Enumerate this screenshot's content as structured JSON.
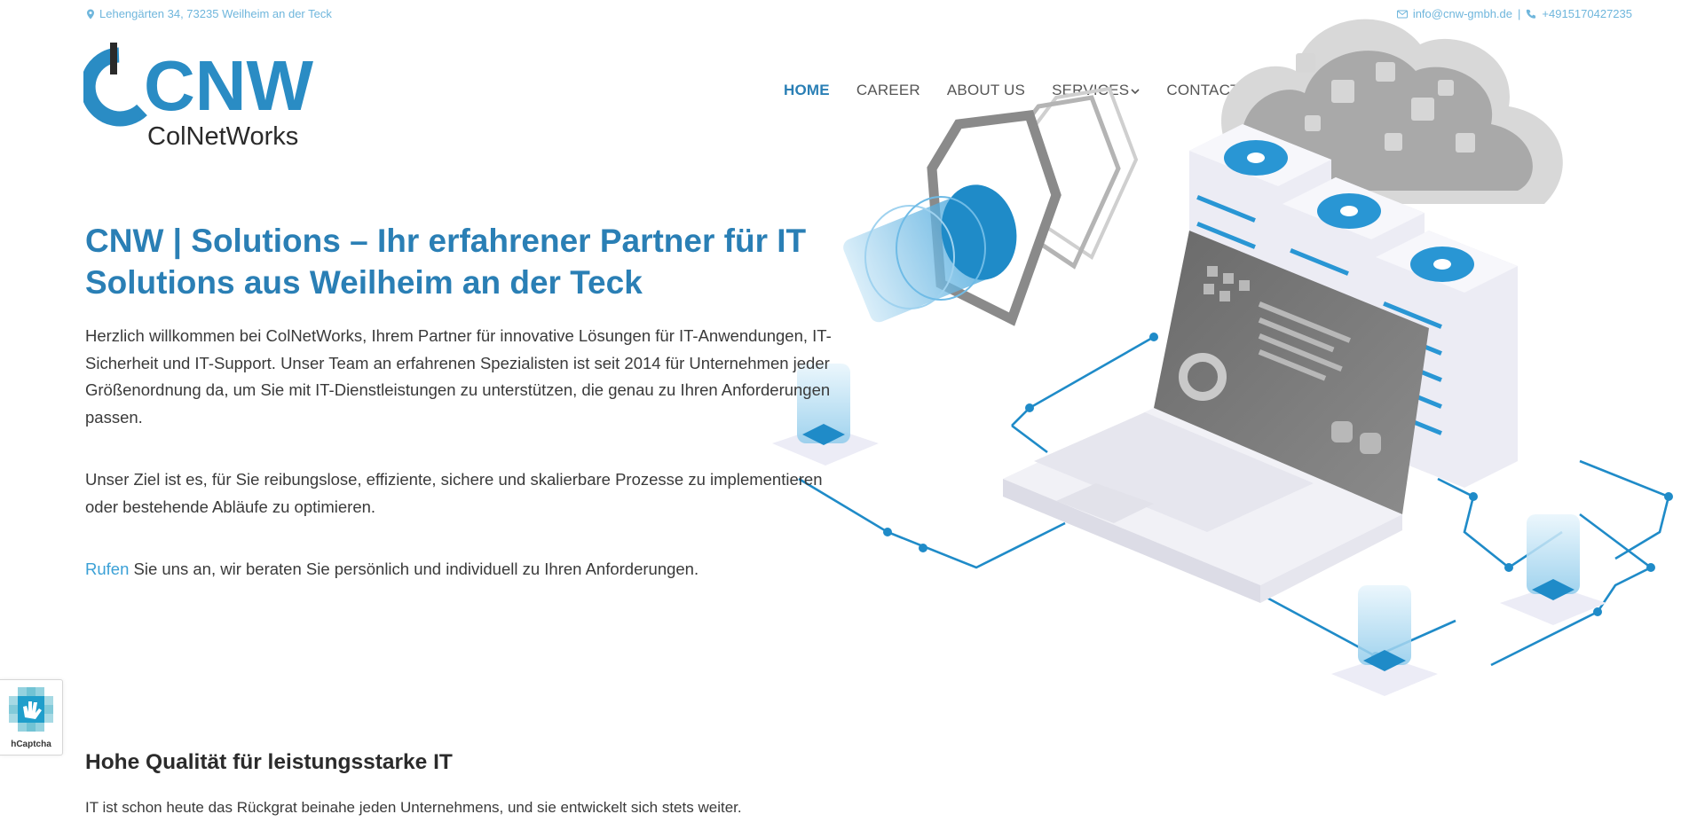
{
  "topbar": {
    "address": "Lehengärten 34, 73235 Weilheim an der Teck",
    "email": "info@cnw-gmbh.de",
    "separator": "|",
    "phone": "+4915170427235"
  },
  "logo": {
    "mark": "CNW",
    "name": "ColNetWorks"
  },
  "nav": {
    "items": [
      {
        "label": "HOME"
      },
      {
        "label": "CAREER"
      },
      {
        "label": "ABOUT US"
      },
      {
        "label": "SERVICES"
      },
      {
        "label": "CONTACT"
      }
    ]
  },
  "hero": {
    "title": "CNW | Solutions – Ihr erfahrener Partner für IT Solutions aus Weilheim an der Teck",
    "paragraph1": "Herzlich willkommen bei ColNetWorks, Ihrem Partner für innovative Lösungen für IT-Anwendungen, IT-Sicherheit und IT-Support. Unser Team an erfahrenen Spezialisten ist seit 2014 für Unternehmen jeder Größenordnung da, um Sie mit IT-Dienstleistungen zu unterstützen, die genau zu Ihren Anforderungen passen.",
    "paragraph2": "Unser Ziel ist es, für Sie reibungslose, effiziente, sichere und skalierbare Prozesse zu implementieren oder bestehende Abläufe zu optimieren.",
    "call_link": "Rufen",
    "call_text": " Sie uns an, wir beraten Sie persönlich und individuell zu Ihren Anforderungen."
  },
  "quality": {
    "heading": "Hohe Qualität für leistungsstarke IT",
    "text": "IT ist schon heute das Rückgrat beinahe jeden Unternehmens, und sie entwickelt sich stets weiter."
  },
  "captcha": {
    "label": "hCaptcha"
  },
  "colors": {
    "brand": "#2a7fb5",
    "accent": "#3aa0d6",
    "topbar": "#6fb6dc"
  }
}
